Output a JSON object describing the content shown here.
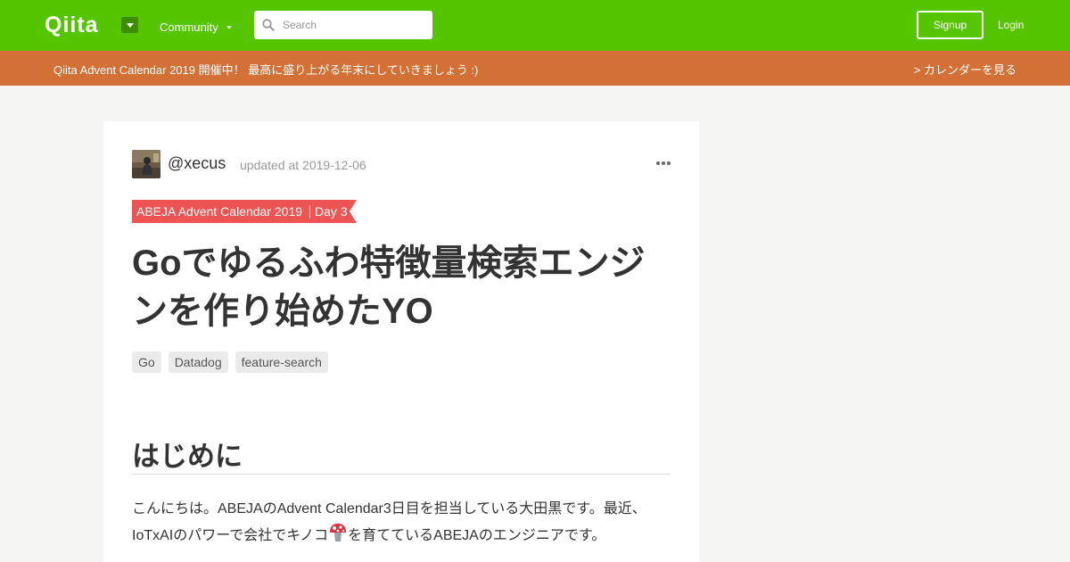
{
  "header": {
    "logo": "Qiita",
    "community_label": "Community",
    "search_placeholder": "Search",
    "signup_label": "Signup",
    "login_label": "Login"
  },
  "banner": {
    "text": "Qiita Advent Calendar 2019 開催中！ 最高に盛り上がる年末にしていきましょう :)",
    "link_text": "> カレンダーを見る"
  },
  "article": {
    "author": "@xecus",
    "updated": "updated at 2019-12-06",
    "calendar_name": "ABEJA Advent Calendar 2019",
    "calendar_day": "Day 3",
    "title": "Goでゆるふわ特徴量検索エンジンを作り始めたYO",
    "tags": [
      "Go",
      "Datadog",
      "feature-search"
    ],
    "section_heading": "はじめに",
    "intro_before_emoji": "こんにちは。ABEJAのAdvent Calendar3日目を担当している大田黒です。最近、IoTxAIのパワーで会社でキノコ",
    "emoji": "mushroom-icon",
    "intro_after_emoji": "を育てているABEJAのエンジニアです。"
  },
  "colors": {
    "header_green": "#55c500",
    "banner_orange": "#d27036",
    "ribbon_red": "#ef5454",
    "background": "#f5f5f4"
  }
}
